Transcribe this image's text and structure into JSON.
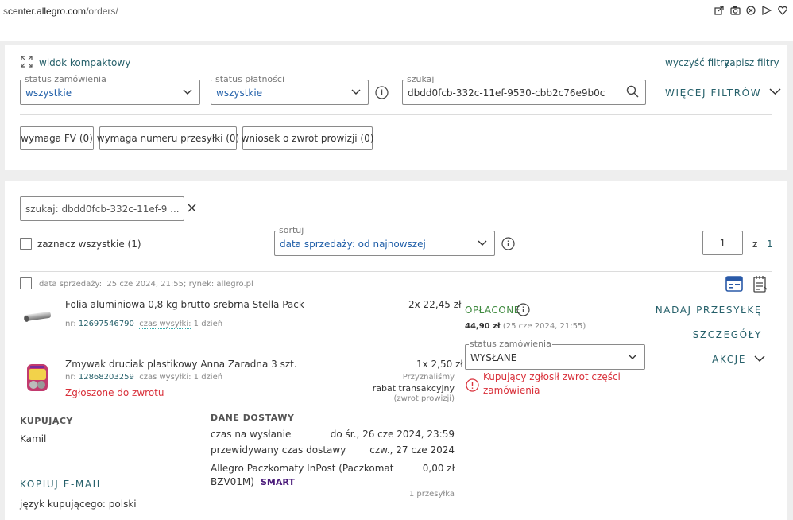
{
  "browser": {
    "url_prefix": "s",
    "url_host": "center.allegro.com",
    "url_path": "/orders/"
  },
  "filters": {
    "compact_view": "widok kompaktowy",
    "clear_filters": "wyczyść filtry",
    "save_filters": "zapisz filtry",
    "order_status": {
      "label": "status zamówienia",
      "value": "wszystkie"
    },
    "payment_status": {
      "label": "status płatności",
      "value": "wszystkie"
    },
    "search": {
      "label": "szukaj",
      "value": "dbdd0fcb-332c-11ef-9530-cbb2c76e9b0c"
    },
    "more_filters": "WIĘCEJ FILTRÓW",
    "chips": [
      "wymaga FV (0)",
      "wymaga numeru przesyłki (0)",
      "wniosek o zwrot prowizji (0)"
    ]
  },
  "list": {
    "active_search": "szukaj: dbdd0fcb-332c-11ef-9 ...",
    "select_all": "zaznacz wszystkie (1)",
    "sort": {
      "label": "sortuj",
      "value": "data sprzedaży: od najnowszej"
    },
    "page": {
      "current": "1",
      "of": "z",
      "total": "1"
    }
  },
  "order": {
    "sale_date_label": "data sprzedaży:",
    "sale_date": "25 cze 2024, 21:55; rynek: allegro.pl",
    "items": [
      {
        "name": "Folia aluminiowa 0,8 kg brutto srebrna Stella Pack",
        "qty_price": "2x 22,45 zł",
        "nr_label": "nr:",
        "nr": "12697546790",
        "ship_label": "czas wysyłki:",
        "ship_time": "1 dzień"
      },
      {
        "name": "Zmywak druciak plastikowy Anna Zaradna 3 szt.",
        "qty_price": "1x 2,50 zł",
        "nr_label": "nr:",
        "nr": "12868203259",
        "ship_label": "czas wysyłki:",
        "ship_time": "1 dzień",
        "return_note": "Zgłoszone do zwrotu",
        "discount_note1": "Przyznaliśmy",
        "discount_note2": "rabat transakcyjny",
        "discount_note3": "(zwrot prowizji)"
      }
    ],
    "payment_status": "OPŁACONE",
    "payment_amount": "44,90 zł",
    "payment_date": "(25 cze 2024, 21:55)",
    "status_field": {
      "label": "status zamówienia",
      "value": "WYSŁANE"
    },
    "return_warning1": "Kupujący zgłosił zwrot części",
    "return_warning2": "zamówienia",
    "actions": {
      "ship": "NADAJ PRZESYŁKĘ",
      "details": "SZCZEGÓŁY",
      "actions": "AKCJE"
    },
    "buyer": {
      "heading": "KUPUJĄCY",
      "name": "Kamil",
      "copy_email": "KOPIUJ E-MAIL",
      "language": "język kupującego: polski"
    },
    "delivery": {
      "heading": "DANE DOSTAWY",
      "ship_by_label": "czas na wysłanie",
      "ship_by_value": "do śr., 26 cze 2024, 23:59",
      "expected_label": "przewidywany czas dostawy",
      "expected_value": "czw., 27 cze 2024",
      "method_line1": "Allegro Paczkomaty InPost (Paczkomat",
      "method_line2": "BZV01M)",
      "smart": "SMART",
      "cost": "0,00 zł",
      "packages": "1 przesyłka"
    }
  },
  "colors": {
    "accent": "#26606a",
    "link_blue": "#1f5ea8",
    "red": "#d9303a",
    "green": "#3f8a3f"
  }
}
